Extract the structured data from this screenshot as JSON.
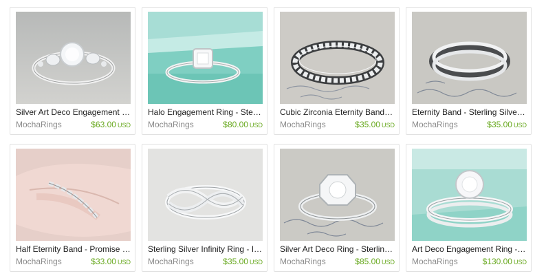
{
  "listings": [
    {
      "title": "Silver Art Deco Engagement …",
      "shop": "MochaRings",
      "price": "$63.00",
      "currency": "USD",
      "image": "art-deco-ring-photo"
    },
    {
      "title": "Halo Engagement Ring - Ster…",
      "shop": "MochaRings",
      "price": "$80.00",
      "currency": "USD",
      "image": "halo-ring-teal-box-photo"
    },
    {
      "title": "Cubic Zirconia Eternity Band …",
      "shop": "MochaRings",
      "price": "$35.00",
      "currency": "USD",
      "image": "eternity-band-photo"
    },
    {
      "title": "Eternity Band - Sterling Silver…",
      "shop": "MochaRings",
      "price": "$35.00",
      "currency": "USD",
      "image": "stacked-bands-photo"
    },
    {
      "title": "Half Eternity Band - Promise …",
      "shop": "MochaRings",
      "price": "$33.00",
      "currency": "USD",
      "image": "ring-on-finger-photo"
    },
    {
      "title": "Sterling Silver Infinity Ring - I…",
      "shop": "MochaRings",
      "price": "$35.00",
      "currency": "USD",
      "image": "infinity-ring-photo"
    },
    {
      "title": "Silver Art Deco Ring - Sterlin…",
      "shop": "MochaRings",
      "price": "$85.00",
      "currency": "USD",
      "image": "art-deco-set-photo"
    },
    {
      "title": "Art Deco Engagement Ring - …",
      "shop": "MochaRings",
      "price": "$130.00",
      "currency": "USD",
      "image": "engagement-set-teal-photo"
    }
  ]
}
